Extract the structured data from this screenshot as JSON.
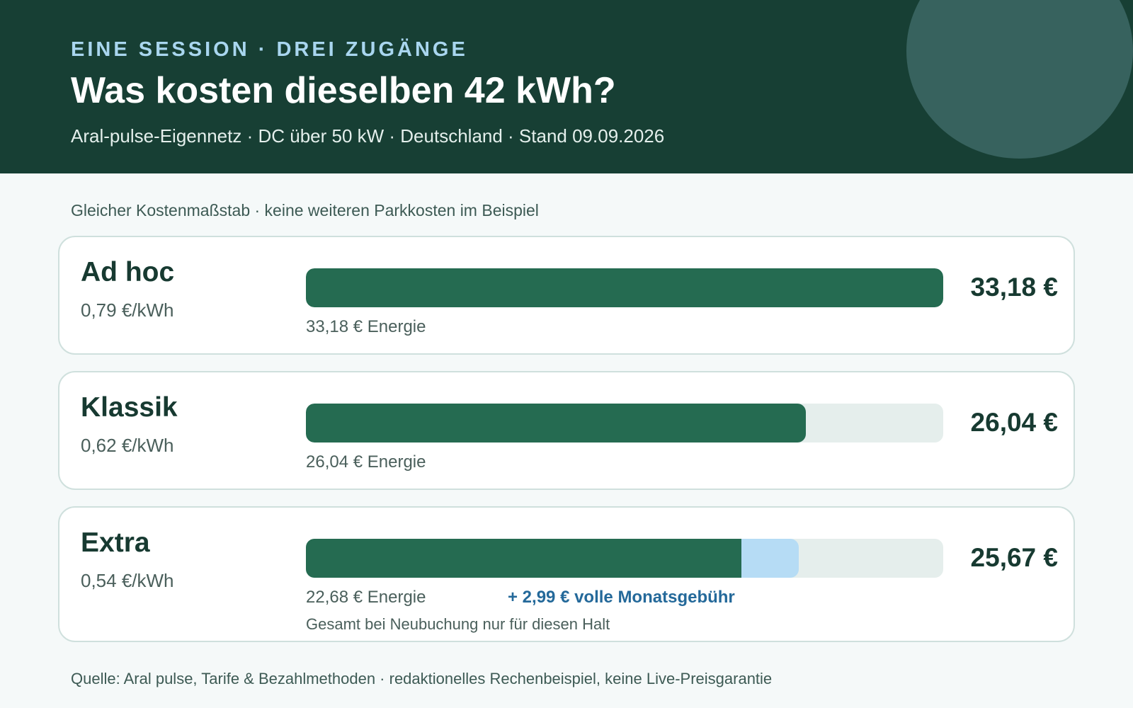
{
  "header": {
    "eyebrow": "EINE SESSION · DREI ZUGÄNGE",
    "title": "Was kosten dieselben 42 kWh?",
    "subtitle": "Aral-pulse-Eigennetz · DC über 50 kW · Deutschland · Stand 09.09.2026"
  },
  "intro": "Gleicher Kostenmaßstab · keine weiteren Parkkosten im Beispiel",
  "source": "Quelle: Aral pulse, Tarife & Bezahlmethoden · redaktionelles Rechenbeispiel, keine Live-Preisgarantie",
  "colors": {
    "header_bg": "#173f34",
    "energy_bar": "#256b51",
    "fee_bar": "#b6dcf5",
    "track": "#e5eeec",
    "fee_text": "#24699a"
  },
  "chart_data": {
    "type": "bar",
    "orientation": "horizontal",
    "stacked": true,
    "xlim": [
      0,
      33.18
    ],
    "categories": [
      "Ad hoc",
      "Klassik",
      "Extra"
    ],
    "series": [
      {
        "name": "Energie",
        "values": [
          33.18,
          26.04,
          22.68
        ]
      },
      {
        "name": "Monatsgebühr",
        "values": [
          0,
          0,
          2.99
        ]
      }
    ]
  },
  "cards": [
    {
      "name": "Ad hoc",
      "rate": "0,79 €/kWh",
      "total": "33,18 €",
      "energy_label": "33,18 € Energie",
      "energy_value": 33.18,
      "fee_value": 0
    },
    {
      "name": "Klassik",
      "rate": "0,62 €/kWh",
      "total": "26,04 €",
      "energy_label": "26,04 € Energie",
      "energy_value": 26.04,
      "fee_value": 0
    },
    {
      "name": "Extra",
      "rate": "0,54 €/kWh",
      "total": "25,67 €",
      "energy_label": "22,68 € Energie",
      "fee_label": "+ 2,99 € volle Monatsgebühr",
      "note": "Gesamt bei Neubuchung nur für diesen Halt",
      "energy_value": 22.68,
      "fee_value": 2.99
    }
  ]
}
